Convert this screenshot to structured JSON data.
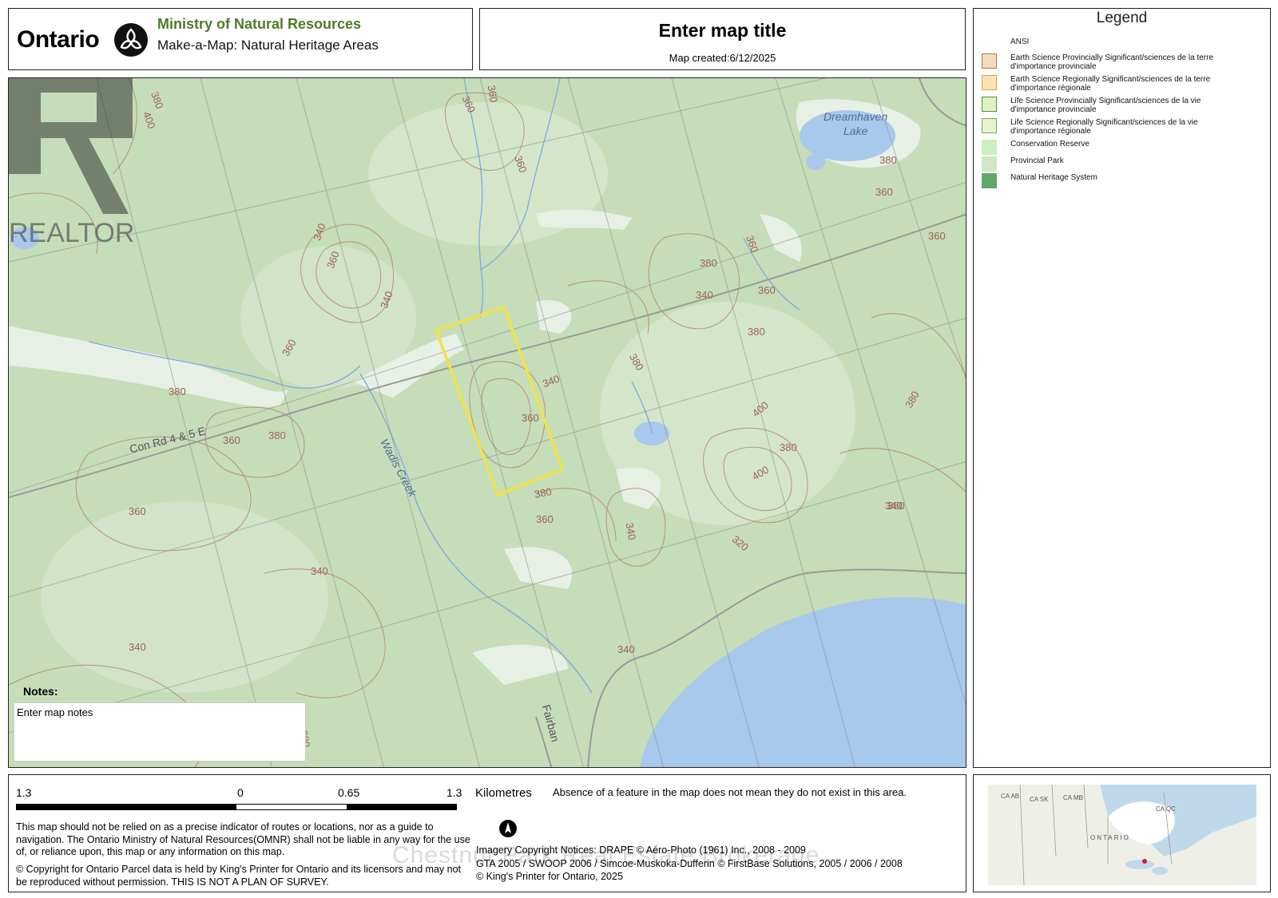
{
  "header": {
    "ontario_wordmark": "Ontario",
    "ministry": "Ministry of Natural Resources",
    "app_name": "Make-a-Map: Natural Heritage Areas",
    "map_title": "Enter map title",
    "map_created": "Map created:6/12/2025"
  },
  "legend": {
    "title": "Legend",
    "group": "ANSI",
    "items": [
      {
        "label_1": "Earth Science Provincially Significant/sciences de la terre",
        "label_2": "d'importance provinciale",
        "swatch": "#f1dcc0",
        "border": "#c0703a"
      },
      {
        "label_1": "Earth Science Regionally Significant/sciences de la terre",
        "label_2": "d'importance régionale",
        "swatch": "#f6e4b4",
        "border": "#d6a040"
      },
      {
        "label_1": "Life Science Provincially Significant/sciences de la vie",
        "label_2": "d'importance provinciale",
        "swatch": "#dff0c8",
        "border": "#5c8a3a"
      },
      {
        "label_1": "Life Science Regionally Significant/sciences de la vie",
        "label_2": "d'importance régionale",
        "swatch": "#e6f2d2",
        "border": "#7aa84e"
      },
      {
        "label_1": "Conservation Reserve",
        "label_2": "",
        "swatch": "#c9efc0",
        "border": "#c9efc0"
      },
      {
        "label_1": "Provincial Park",
        "label_2": "",
        "swatch": "#cfe7c4",
        "border": "#cfe7c4"
      },
      {
        "label_1": "Natural Heritage System",
        "label_2": "",
        "swatch": "#5fa86a",
        "border": "#5fa86a"
      }
    ]
  },
  "map": {
    "lake_label_1": "Dreamhaven",
    "lake_label_2": "Lake",
    "road_label": "Con Rd 4 & 5 E",
    "creek_label": "Wadis Creek",
    "road_label_2": "Fairban",
    "contours": [
      "380",
      "400",
      "360",
      "360",
      "360",
      "340",
      "360",
      "340",
      "360",
      "380",
      "360",
      "380",
      "360",
      "340",
      "340",
      "340",
      "360",
      "380",
      "360",
      "380",
      "340",
      "360",
      "380",
      "380",
      "360",
      "360",
      "380",
      "400",
      "380",
      "400",
      "340",
      "340",
      "320",
      "380",
      "360",
      "380",
      "340",
      "380"
    ],
    "notes_title": "Notes:",
    "notes_placeholder": "Enter map notes",
    "watermark": "REALTOR"
  },
  "footer": {
    "scale_left": "1.3",
    "scale_zero": "0",
    "scale_mid": "0.65",
    "scale_right": "1.3",
    "units": "Kilometres",
    "absence_note": "Absence of a feature in the map does not mean they do not exist in this area.",
    "disclaimer": "This map should not be relied on as a precise indicator of routes or locations, nor as a guide to navigation. The Ontario Ministry of Natural Resources(OMNR) shall not be liable in any way for the use of, or reliance upon, this map or any information on this map.",
    "copyright": "© Copyright for Ontario Parcel data is held by King's Printer for Ontario and its licensors and may not be reproduced without permission. THIS IS NOT A PLAN OF SURVEY.",
    "imagery_1": "Imagery Copyright Notices: DRAPE © Aéro-Photo (1961) Inc., 2008 - 2009",
    "imagery_2": "GTA 2005 / SWOOP 2006 / Simcoe-Muskoka-Dufferin © FirstBase Solutions, 2005 / 2006 / 2008",
    "imagery_3": "© King's Printer for Ontario,  2025",
    "watermark": "Chestnut Park Real Estate Brokerage"
  },
  "inset": {
    "labels": [
      "CA AB",
      "CA SK",
      "CA MB",
      "CA QC",
      "ONTARIO"
    ]
  },
  "colors": {
    "ministry_green": "#4d7a2c",
    "parcel_outline": "#f2e24a",
    "contour": "#b07a64",
    "water": "#a8c8ec",
    "land": "#c5ddb9"
  }
}
